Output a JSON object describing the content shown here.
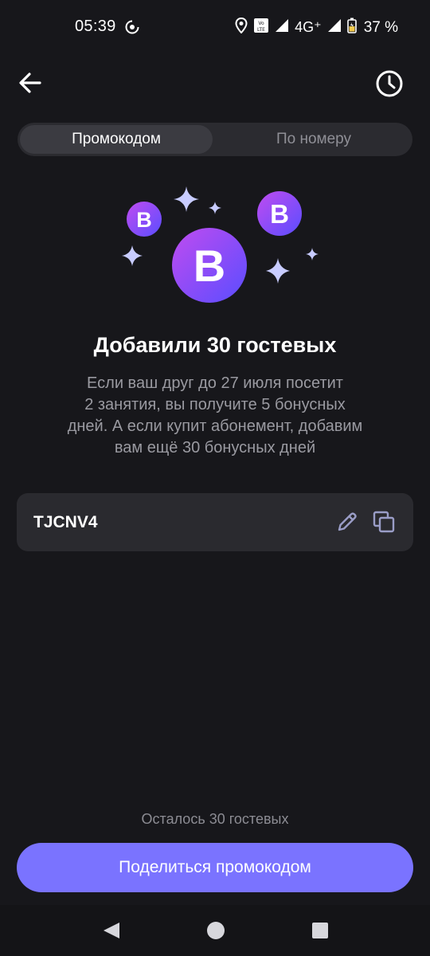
{
  "status_bar": {
    "time": "05:39",
    "network": "4G⁺",
    "battery": "37 %",
    "icons": [
      "sync-icon",
      "location-icon",
      "volte-icon",
      "signal-icon",
      "battery-icon"
    ]
  },
  "header": {
    "back_icon": "arrow-left-icon",
    "history_icon": "clock-icon"
  },
  "tabs": [
    {
      "label": "Промокодом",
      "active": true
    },
    {
      "label": "По номеру",
      "active": false
    }
  ],
  "illustration": {
    "badge_letter": "B",
    "colors": {
      "gradient_start": "#c04cf0",
      "gradient_end": "#5a4dff",
      "sparkle": "#c8ccff"
    }
  },
  "content": {
    "title": "Добавили 30 гостевых",
    "description_lines": [
      "Если ваш друг до 27 июля посетит",
      "2 занятия, вы получите 5 бонусных",
      "дней. А если купит абонемент, добавим",
      "вам ещё 30 бонусных дней"
    ]
  },
  "promo": {
    "code": "TJCNV4",
    "edit_icon": "pencil-icon",
    "copy_icon": "copy-icon"
  },
  "footer": {
    "remaining_text": "Осталось 30 гостевых",
    "share_label": "Поделиться промокодом",
    "accent_color": "#7a73ff"
  },
  "nav": {
    "icons": [
      "nav-back-icon",
      "nav-home-icon",
      "nav-recents-icon"
    ]
  }
}
